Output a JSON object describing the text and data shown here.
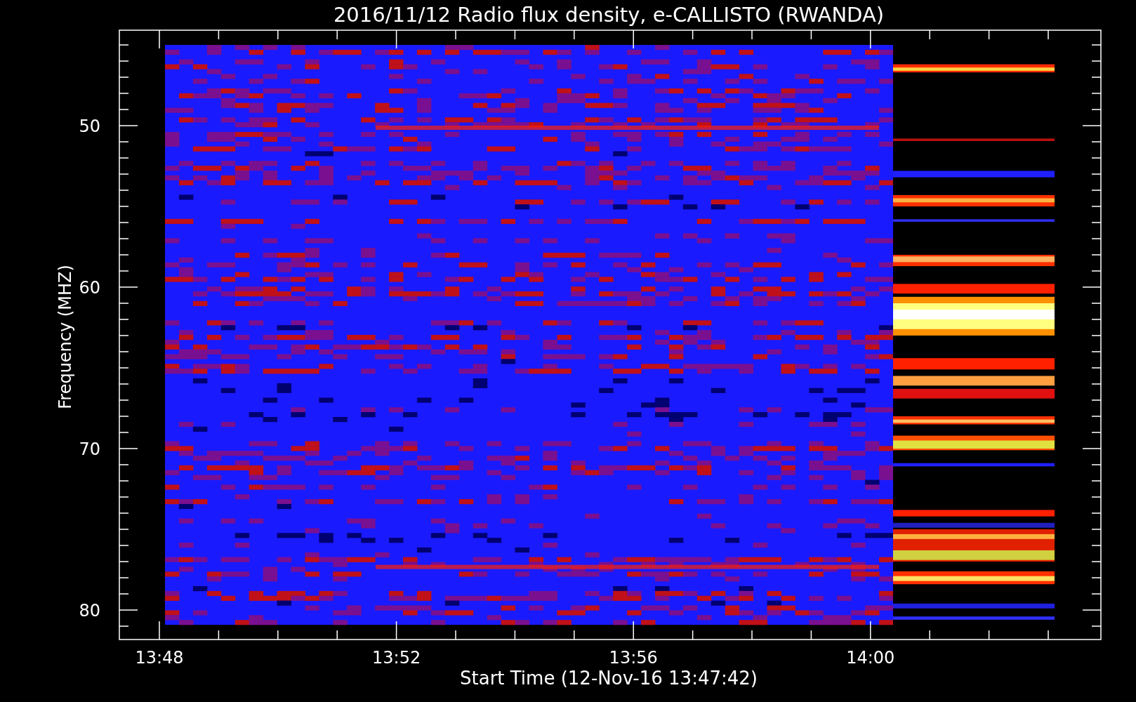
{
  "title": "2016/11/12  Radio flux density, e-CALLISTO (RWANDA)",
  "y_axis": {
    "label": "Frequency (MHZ)",
    "ticks": [
      "50",
      "60",
      "70",
      "80"
    ]
  },
  "x_axis": {
    "label": "Start Time (12-Nov-16 13:47:42)",
    "ticks": [
      "13:48",
      "13:52",
      "13:56",
      "14:00"
    ]
  }
}
